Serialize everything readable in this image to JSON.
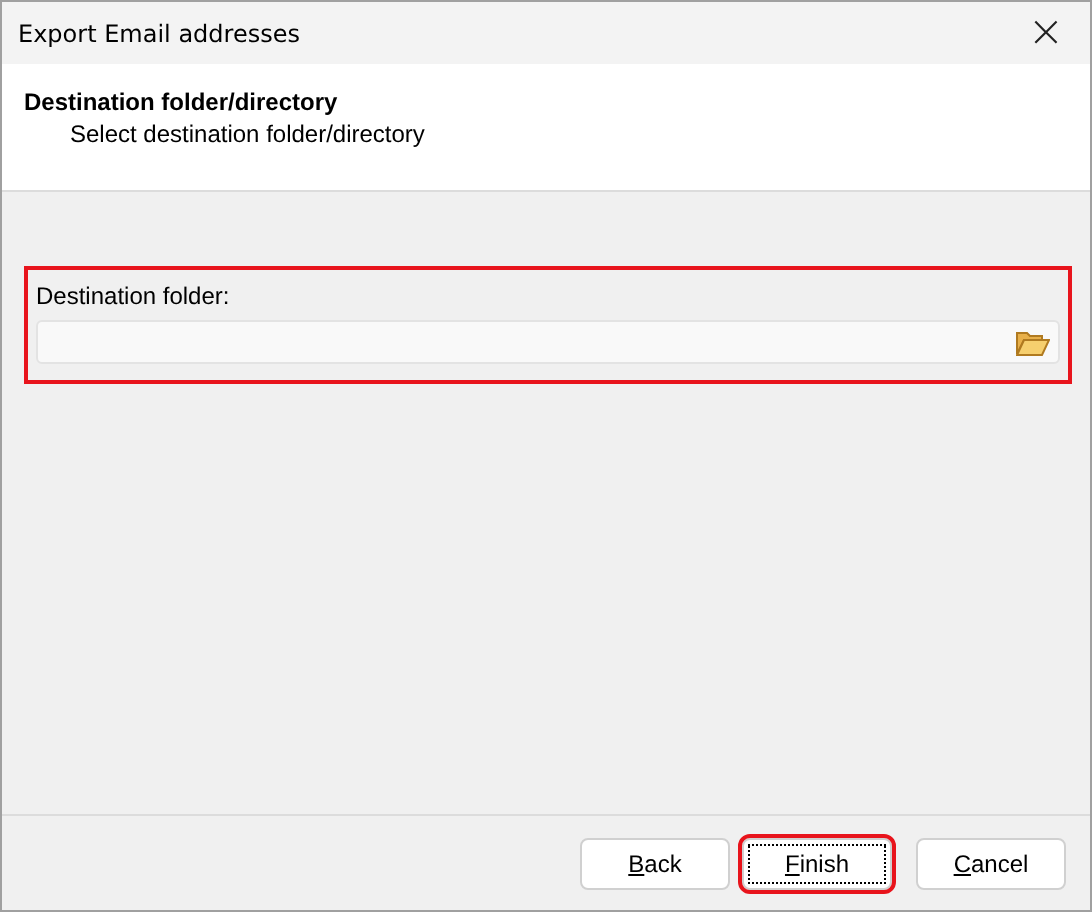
{
  "window": {
    "title": "Export Email addresses",
    "close": "×"
  },
  "header": {
    "title": "Destination folder/directory",
    "subtitle": "Select destination folder/directory"
  },
  "destination_group": {
    "highlighted": true,
    "label": "Destination folder:"
  },
  "buttons": [
    {
      "label": "Back",
      "access_key": true,
      "focused": false,
      "highlighted": false
    },
    {
      "label": "Finish",
      "access_key": true,
      "focused": true,
      "highlighted": true
    },
    {
      "label": "Cancel",
      "access_key": true,
      "focused": false,
      "highlighted": false
    }
  ]
}
